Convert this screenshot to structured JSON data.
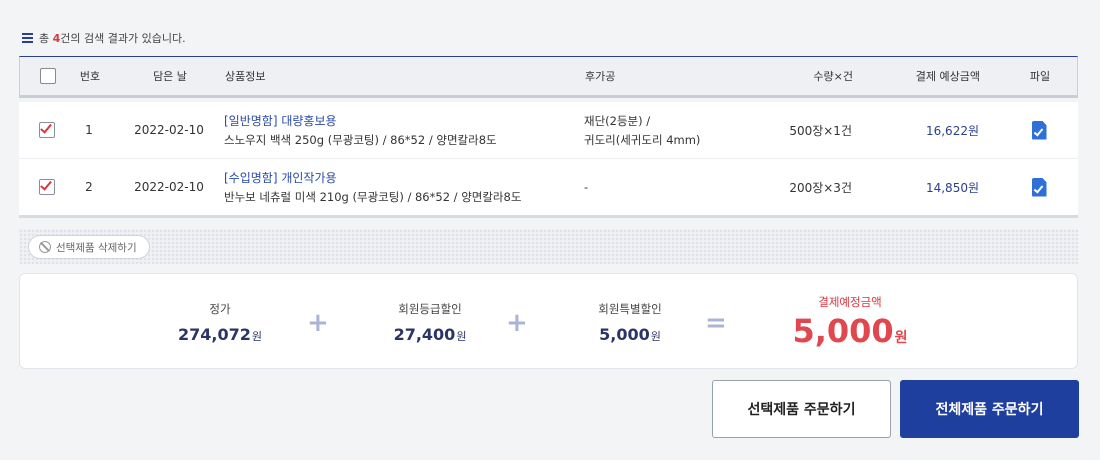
{
  "summary": {
    "prefix": "총 ",
    "count": "4",
    "suffix": "건의 검색 결과가 있습니다."
  },
  "table": {
    "headers": {
      "no": "번호",
      "date": "담은 날",
      "info": "상품정보",
      "post": "후가공",
      "qty": "수량×건",
      "amount": "결제 예상금액",
      "file": "파일"
    },
    "rows": [
      {
        "checked": true,
        "no": "1",
        "date": "2022-02-10",
        "title": "[일반명함] 대량홍보용",
        "spec": "스노우지 백색 250g (무광코팅) / 86*52 / 양면칼라8도",
        "post_line1": "재단(2등분) /",
        "post_line2": "귀도리(세귀도리 4mm)",
        "qty": "500장×1건",
        "amount": "16,622원"
      },
      {
        "checked": true,
        "no": "2",
        "date": "2022-02-10",
        "title": "[수입명함] 개인작가용",
        "spec": "반누보 네츄럴 미색 210g (무광코팅) / 86*52 / 양면칼라8도",
        "post_line1": "-",
        "post_line2": "",
        "qty": "200장×3건",
        "amount": "14,850원"
      }
    ]
  },
  "delete_button": "선택제품 삭제하기",
  "totals": {
    "list_price_label": "정가",
    "list_price": "274,072",
    "grade_discount_label": "회원등급할인",
    "grade_discount": "27,400",
    "special_discount_label": "회원특별할인",
    "special_discount": "5,000",
    "expected_label": "결제예정금액",
    "expected": "5,000",
    "unit": "원",
    "plus": "+",
    "equals": "="
  },
  "buttons": {
    "order_selected": "선택제품 주문하기",
    "order_all": "전체제품 주문하기"
  },
  "colors": {
    "accent_navy": "#1f3f9e",
    "highlight_red": "#e0474f",
    "link_blue": "#2a4aa8"
  }
}
